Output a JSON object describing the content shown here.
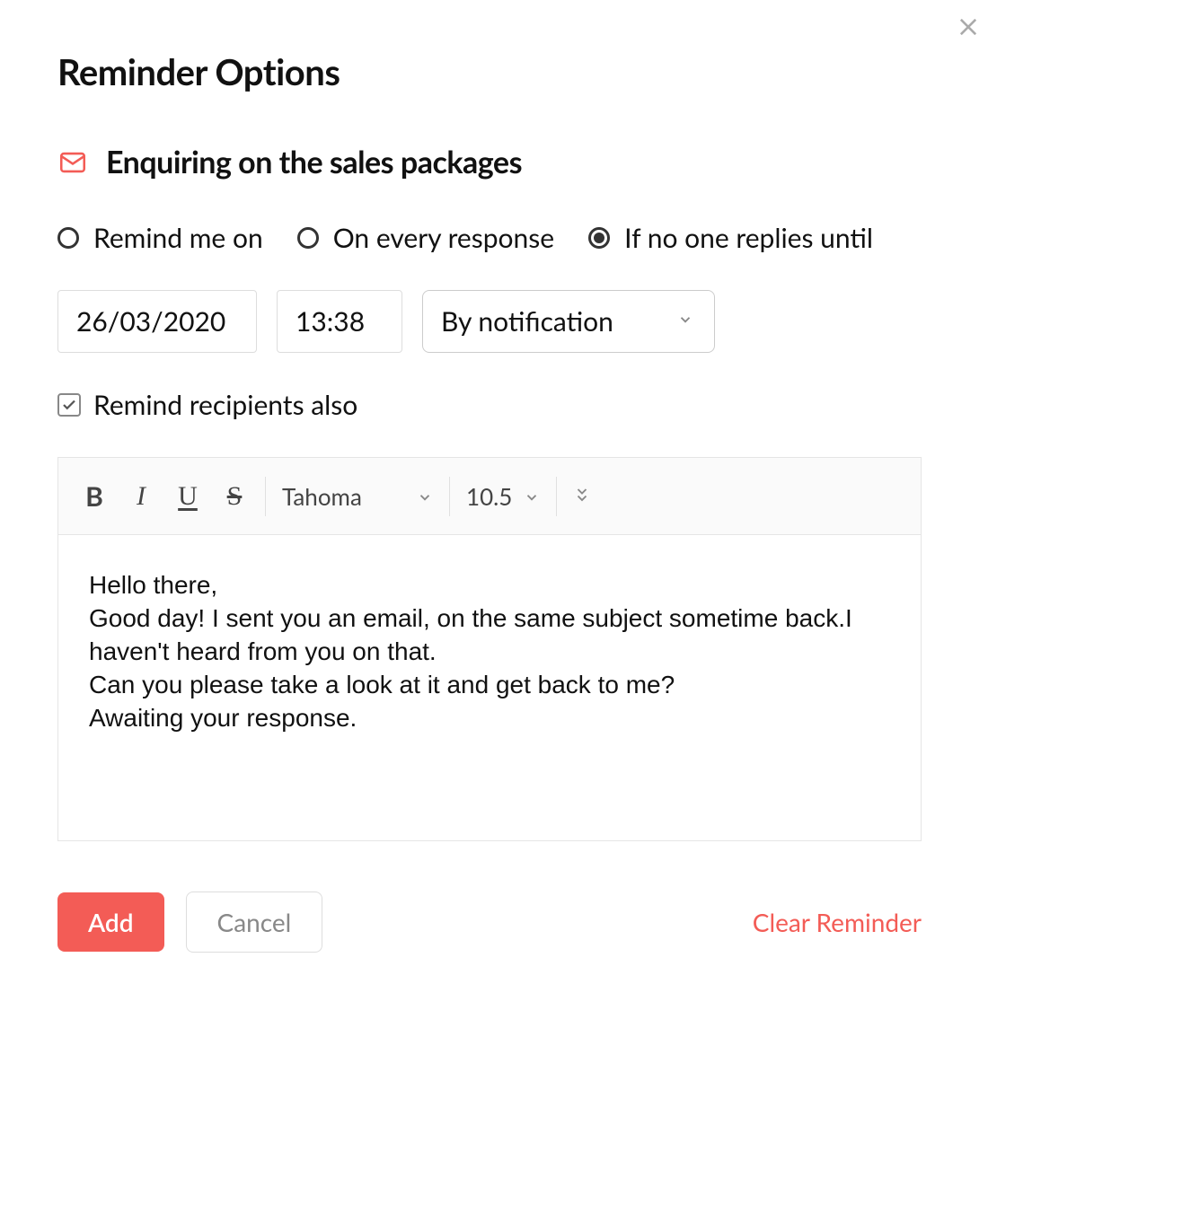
{
  "title": "Reminder Options",
  "subject": "Enquiring on the sales packages",
  "radios": {
    "remind_on": "Remind me on",
    "every_response": "On every response",
    "no_reply_until": "If no one replies until",
    "selected": "no_reply_until"
  },
  "inputs": {
    "date": "26/03/2020",
    "time": "13:38",
    "method": "By notification"
  },
  "checkbox": {
    "label": "Remind recipients also",
    "checked": true
  },
  "toolbar": {
    "bold": "B",
    "italic": "I",
    "underline": "U",
    "strike": "S",
    "font": "Tahoma",
    "size": "10.5"
  },
  "body": "Hello there,\nGood day! I sent you an email, on the same subject sometime back.I haven't heard from you on that.\nCan you please take a look at it and get back to me?\nAwaiting your response.",
  "footer": {
    "add": "Add",
    "cancel": "Cancel",
    "clear": "Clear Reminder"
  }
}
